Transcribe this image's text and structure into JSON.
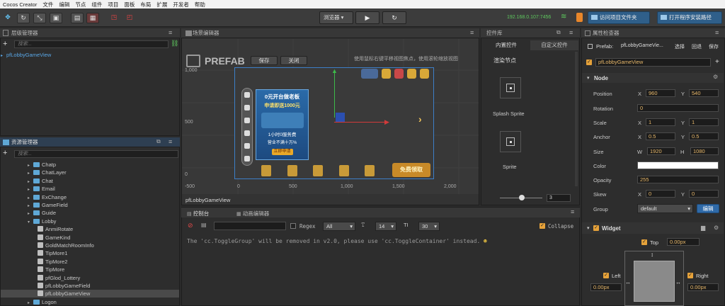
{
  "app": {
    "title": "Cocos Creator",
    "menus": [
      "文件",
      "编辑",
      "节点",
      "组件",
      "项目",
      "面板",
      "布局",
      "扩展",
      "开发者",
      "帮助"
    ]
  },
  "toolbar": {
    "preview_select": "浏览器",
    "ip_address": "192.168.0.107:7456",
    "open_project_folder": "访问项目文件夹",
    "open_install_path": "打开程序安装路径"
  },
  "hierarchy": {
    "title": "层级管理器",
    "search_placeholder": "搜索...",
    "root_node": "pfLobbyGameView"
  },
  "assets": {
    "title": "资源管理器",
    "search_placeholder": "搜索...",
    "items": [
      {
        "label": "Chatp",
        "type": "folder",
        "indent": 1,
        "expanded": false
      },
      {
        "label": "ChatLayer",
        "type": "folder",
        "indent": 1,
        "expanded": false
      },
      {
        "label": "Chat",
        "type": "folder",
        "indent": 1,
        "expanded": false
      },
      {
        "label": "Email",
        "type": "folder",
        "indent": 1,
        "expanded": false
      },
      {
        "label": "ExChange",
        "type": "folder",
        "indent": 1,
        "expanded": false
      },
      {
        "label": "GameField",
        "type": "folder",
        "indent": 1,
        "expanded": false
      },
      {
        "label": "Guide",
        "type": "folder",
        "indent": 1,
        "expanded": false
      },
      {
        "label": "Lobby",
        "type": "folder",
        "indent": 1,
        "expanded": true
      },
      {
        "label": "AnmiRotate",
        "type": "prefab",
        "indent": 2
      },
      {
        "label": "GameKind",
        "type": "prefab",
        "indent": 2
      },
      {
        "label": "GoldMatchRoomInfo",
        "type": "prefab",
        "indent": 2
      },
      {
        "label": "TipMore1",
        "type": "prefab",
        "indent": 2
      },
      {
        "label": "TipMore2",
        "type": "prefab",
        "indent": 2
      },
      {
        "label": "TipMore",
        "type": "prefab",
        "indent": 2
      },
      {
        "label": "pfGlod_Lottery",
        "type": "prefab",
        "indent": 2
      },
      {
        "label": "pfLobbyGameField",
        "type": "prefab",
        "indent": 2
      },
      {
        "label": "pfLobbyGameView",
        "type": "prefab",
        "indent": 2,
        "selected": true
      },
      {
        "label": "Logon",
        "type": "folder",
        "indent": 1,
        "expanded": false
      }
    ]
  },
  "scene": {
    "title": "场景编辑器",
    "prefab_label": "PREFAB",
    "save_button": "保存",
    "close_button": "关闭",
    "hint": "使用鼠标右键平移视图焦点，使用滚轮缩放视图",
    "y_ticks": [
      "1,000",
      "500",
      "0"
    ],
    "x_ticks": [
      "-500",
      "0",
      "500",
      "1,000",
      "1,500",
      "2,000"
    ],
    "footer_label": "pfLobbyGameView",
    "banner_line1": "0元开台做老板",
    "banner_line2": "申请即送1000元",
    "banner_line3": "1小时0服务费",
    "banner_line4": "营业不满十万%",
    "banner_button": "立即申请",
    "bottom_icons": [
      "商城",
      "任务",
      "排行榜",
      "邮件",
      "设置"
    ],
    "gift_text": "免费领取"
  },
  "widgets": {
    "title": "控件库",
    "tab_builtin": "内置控件",
    "tab_custom": "自定义控件",
    "section": "渲染节点",
    "items": [
      "Splash Sprite",
      "Sprite"
    ],
    "slider_value": "3"
  },
  "console": {
    "tab_console": "控制台",
    "tab_animation": "动画编辑器",
    "regex_label": "Regex",
    "filter_level": "All",
    "font_size": "14",
    "line_height": "30",
    "collapse_label": "Collapse",
    "message": "The 'cc.ToggleGroup' will be removed in v2.0, please use 'cc.ToggleContainer' instead."
  },
  "inspector": {
    "title": "属性检查器",
    "prefab_label": "Prefab:",
    "prefab_name": "pfLobbyGameVie...",
    "btn_select": "选择",
    "btn_revert": "回退",
    "btn_save": "保存",
    "node_name": "pfLobbyGameView",
    "node_section": "Node",
    "position": {
      "label": "Position",
      "x": "960",
      "y": "540"
    },
    "rotation": {
      "label": "Rotation",
      "value": "0"
    },
    "scale": {
      "label": "Scale",
      "x": "1",
      "y": "1"
    },
    "anchor": {
      "label": "Anchor",
      "x": "0.5",
      "y": "0.5"
    },
    "size": {
      "label": "Size",
      "w": "1920",
      "h": "1080"
    },
    "color_label": "Color",
    "opacity": {
      "label": "Opacity",
      "value": "255"
    },
    "skew": {
      "label": "Skew",
      "x": "0",
      "y": "0"
    },
    "group": {
      "label": "Group",
      "value": "default",
      "edit": "编辑"
    },
    "widget_section": "Widget",
    "top": {
      "label": "Top",
      "value": "0.00px"
    },
    "left": {
      "label": "Left",
      "value": "0.00px"
    },
    "right": {
      "label": "Right",
      "value": "0.00px"
    },
    "axis_x": "X",
    "axis_y": "Y",
    "axis_w": "W",
    "axis_h": "H"
  }
}
